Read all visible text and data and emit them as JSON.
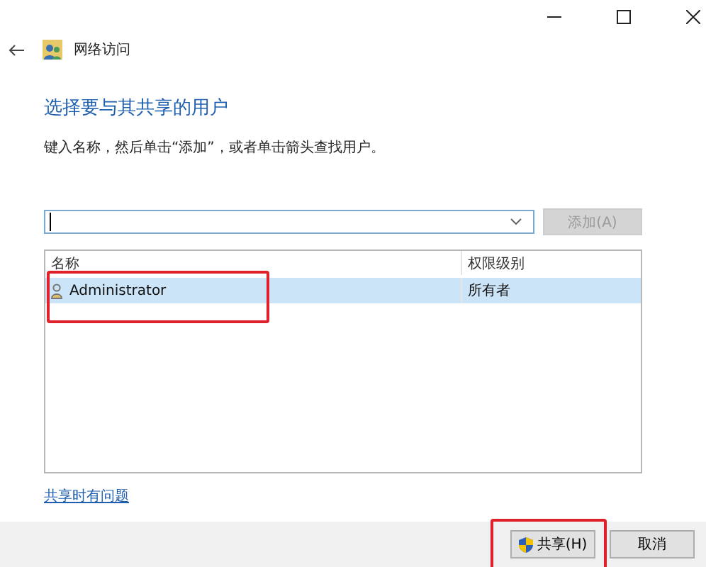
{
  "window": {
    "title": "网络访问"
  },
  "heading": "选择要与其共享的用户",
  "instruction": "键入名称，然后单击“添加”，或者单击箭头查找用户。",
  "add_button": {
    "label": "添加(A)",
    "disabled": true
  },
  "table": {
    "columns": [
      "名称",
      "权限级别"
    ],
    "rows": [
      {
        "name": "Administrator",
        "permission": "所有者",
        "selected": true
      }
    ],
    "highlighted": true
  },
  "help_link": "共享时有问题",
  "buttons": [
    {
      "kind": "shield",
      "label": "共享(H)",
      "highlighted": true
    },
    {
      "kind": "plain",
      "label": "取消",
      "highlighted": false
    }
  ]
}
